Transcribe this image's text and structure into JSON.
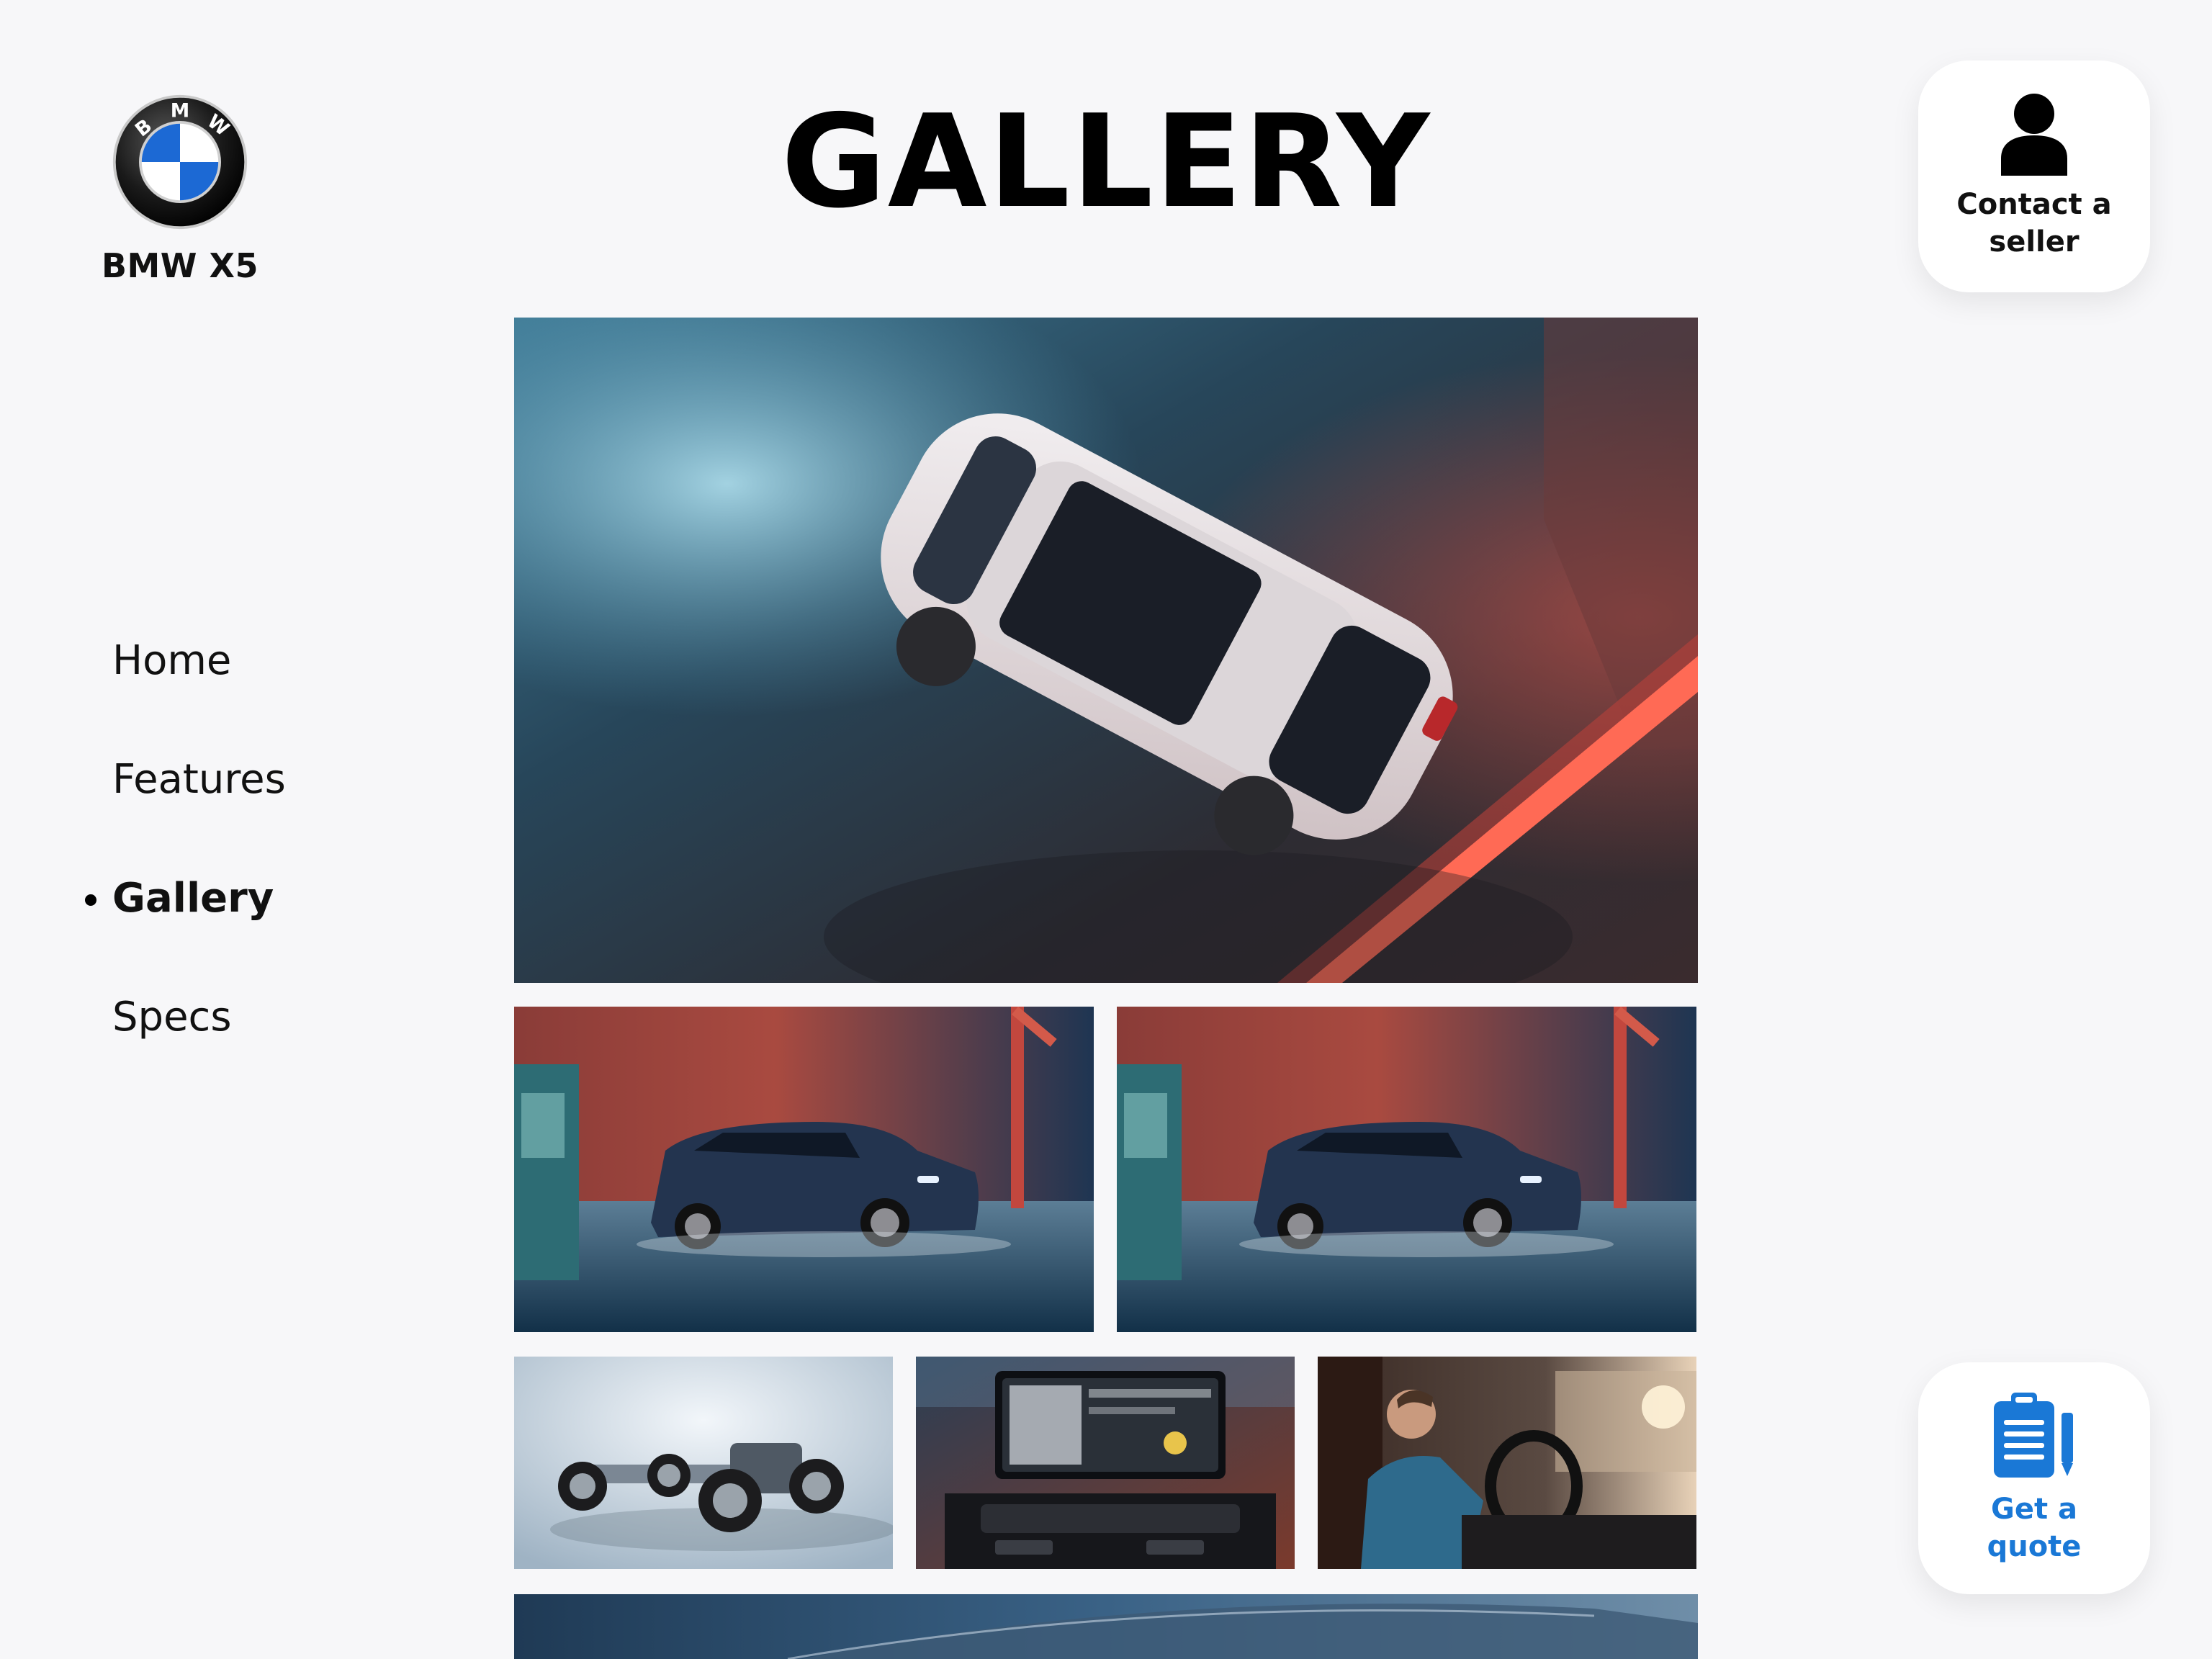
{
  "brand": {
    "name": "BMW X5",
    "logo_icon": "bmw-roundel-icon",
    "logo_letters": "BMW",
    "colors": {
      "blue": "#1c69d4",
      "black": "#111111",
      "white": "#ffffff"
    }
  },
  "page": {
    "title": "GALLERY"
  },
  "nav": {
    "items": [
      {
        "label": "Home",
        "active": false
      },
      {
        "label": "Features",
        "active": false
      },
      {
        "label": "Gallery",
        "active": true
      },
      {
        "label": "Specs",
        "active": false
      }
    ]
  },
  "actions": {
    "contact": {
      "label": "Contact a seller",
      "icon": "person-icon"
    },
    "quote": {
      "label": "Get a quote",
      "icon": "clipboard-pencil-icon",
      "color": "#1a78d6"
    }
  },
  "gallery": {
    "tiles": [
      {
        "subject": "aerial-white-suv"
      },
      {
        "subject": "blue-suv-gas-station"
      },
      {
        "subject": "blue-suv-gas-station"
      },
      {
        "subject": "chassis"
      },
      {
        "subject": "dashboard-screen"
      },
      {
        "subject": "driver-interior"
      },
      {
        "subject": "blue-car-detail"
      }
    ]
  }
}
